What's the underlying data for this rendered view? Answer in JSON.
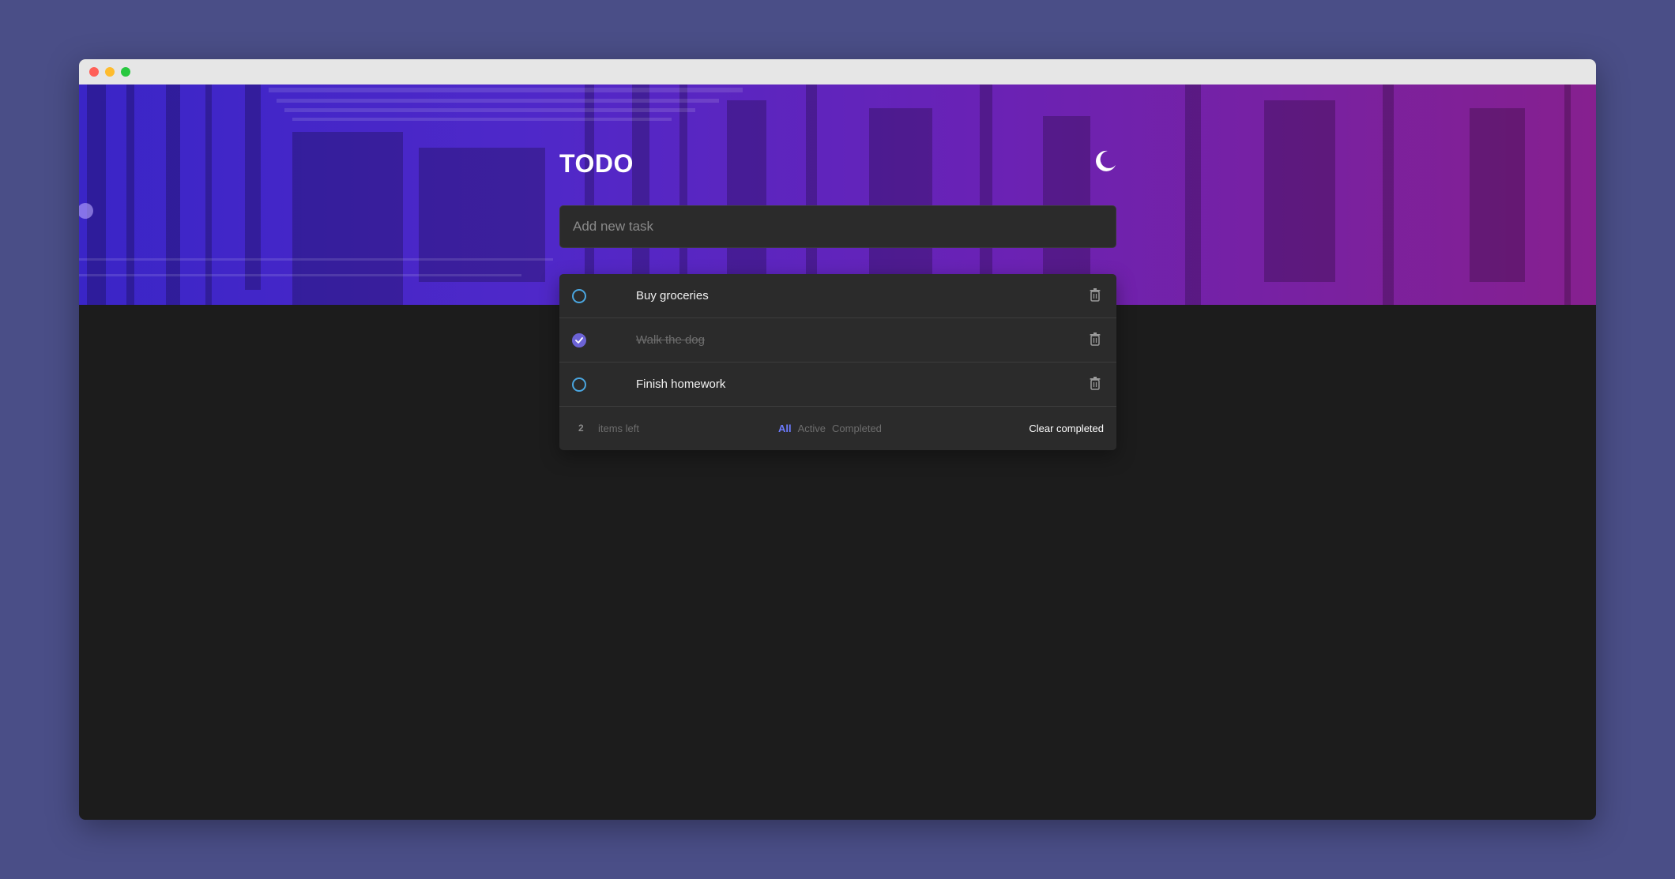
{
  "app": {
    "title": "TODO",
    "theme_icon": "moon-icon"
  },
  "new_task": {
    "placeholder": "Add new task",
    "value": ""
  },
  "todos": [
    {
      "text": "Buy groceries",
      "completed": false
    },
    {
      "text": "Walk the dog",
      "completed": true
    },
    {
      "text": "Finish homework",
      "completed": false
    }
  ],
  "footer": {
    "count": "2",
    "items_left_label": "items left",
    "filters": [
      "All",
      "Active",
      "Completed"
    ],
    "active_filter": "All",
    "clear_label": "Clear completed"
  },
  "colors": {
    "page_bg": "#4a4e87",
    "app_bg": "#1c1c1c",
    "card_bg": "#2b2b2b",
    "accent": "#6c63d6",
    "checkbox_ring": "#4aa6e0",
    "filter_active": "#6c7bff"
  }
}
